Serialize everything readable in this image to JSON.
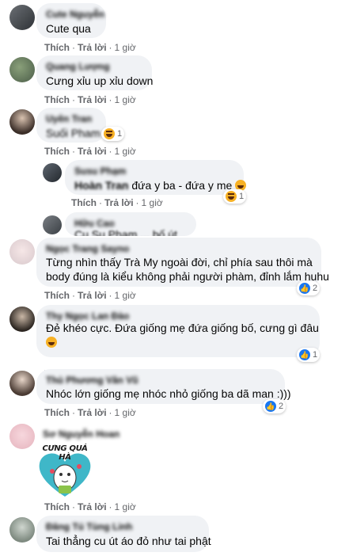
{
  "action_like": "Thích",
  "action_reply": "Trả lời",
  "time_1h": "1 giờ",
  "comments": [
    {
      "name": "Cute Nguyễn",
      "text": "Cute qua"
    },
    {
      "name": "Quang Lượng",
      "text": "Cưng xỉu up xỉu down"
    },
    {
      "name": "Uyên Tran",
      "text": "Suối Pham",
      "reaction_count": "1"
    },
    {
      "name": "Susu Phạm",
      "text_prefix": "Hoàn Tran",
      "text": "đứa y ba - đứa y mẹ",
      "reaction_count": "1"
    },
    {
      "name": "Hữu Cao",
      "text": "Cu Su Phạm ... bố út"
    },
    {
      "name": "Ngọc Trang Sayno",
      "text_line1": "Từng nhìn thấy Trà My ngoài đời, chỉ phía sau thôi mà",
      "text_line2": "body đúng là kiểu không phải người phàm, đỉnh lắm huhu",
      "reaction_count": "2"
    },
    {
      "name": "Thy Ngọc Lan Đào",
      "text_line1": "Đẻ khéo cực. Đứa giống mẹ đứa giống bố, cưng gì đâu",
      "reaction_count": "1"
    },
    {
      "name": "Thủ Phương Vân Vũ",
      "text": "Nhóc lớn giống mẹ nhóc nhỏ giống ba dã man :)))",
      "reaction_count": "2"
    },
    {
      "name": "Sơ Nguyễn Hoan",
      "sticker_text": "CƯNG QUÁ HÀ"
    },
    {
      "name": "Đăng Tú Tùng Linh",
      "text": "Tai thẳng cu út áo đỏ như tai phật"
    }
  ],
  "colors": {
    "bubble": "#f0f2f5",
    "meta": "#65676b",
    "like_blue": "#1877f2",
    "haha": "#f7b125"
  }
}
